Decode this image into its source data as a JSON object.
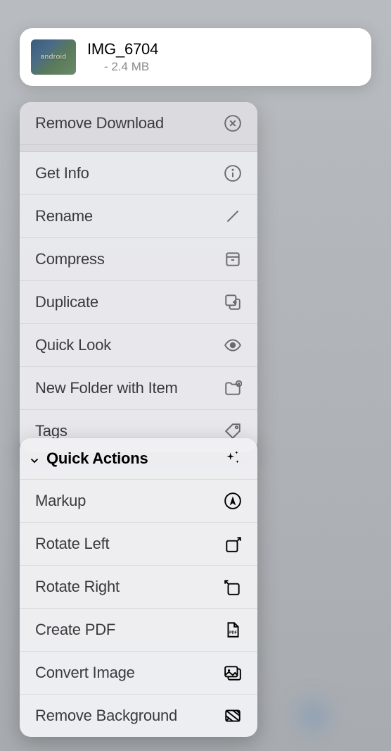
{
  "file": {
    "name": "IMG_6704",
    "size": "- 2.4 MB"
  },
  "menu1": {
    "removeDownload": "Remove Download",
    "getInfo": "Get Info",
    "rename": "Rename",
    "compress": "Compress",
    "duplicate": "Duplicate",
    "quickLook": "Quick Look",
    "newFolderWithItem": "New Folder with Item",
    "tags": "Tags"
  },
  "menu2": {
    "quickActions": "Quick Actions",
    "markup": "Markup",
    "rotateLeft": "Rotate Left",
    "rotateRight": "Rotate Right",
    "createPdf": "Create PDF",
    "convertImage": "Convert Image",
    "removeBackground": "Remove Background"
  },
  "colors": {
    "iconColor": "#6b6b6e"
  }
}
